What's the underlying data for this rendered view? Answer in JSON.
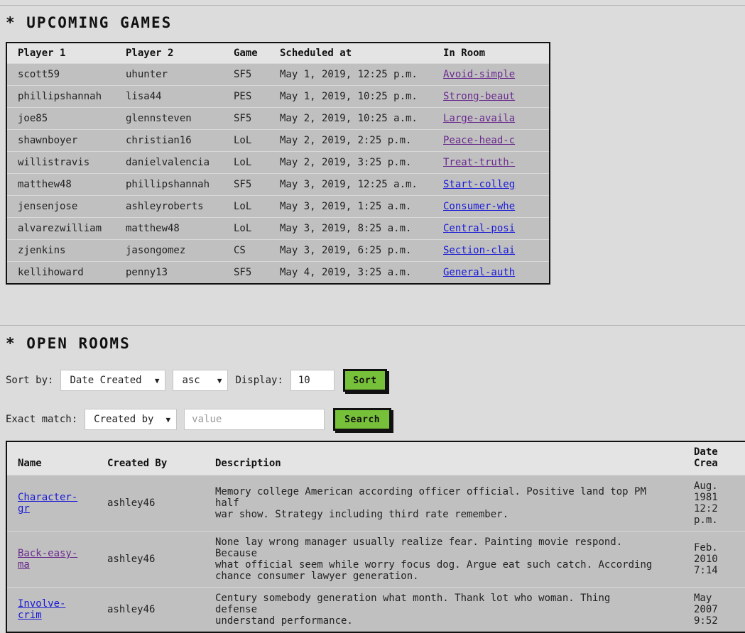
{
  "upcoming": {
    "heading": "* UPCOMING GAMES",
    "columns": [
      "Player 1",
      "Player 2",
      "Game",
      "Scheduled at",
      "In Room"
    ],
    "rows": [
      {
        "p1": "scott59",
        "p2": "uhunter",
        "game": "SF5",
        "when": "May 1, 2019, 12:25 p.m.",
        "room": "Avoid-simple",
        "visited": true
      },
      {
        "p1": "phillipshannah",
        "p2": "lisa44",
        "game": "PES",
        "when": "May 1, 2019, 10:25 p.m.",
        "room": "Strong-beaut",
        "visited": true
      },
      {
        "p1": "joe85",
        "p2": "glennsteven",
        "game": "SF5",
        "when": "May 2, 2019, 10:25 a.m.",
        "room": "Large-availa",
        "visited": true
      },
      {
        "p1": "shawnboyer",
        "p2": "christian16",
        "game": "LoL",
        "when": "May 2, 2019, 2:25 p.m.",
        "room": "Peace-head-c",
        "visited": true
      },
      {
        "p1": "willistravis",
        "p2": "danielvalencia",
        "game": "LoL",
        "when": "May 2, 2019, 3:25 p.m.",
        "room": "Treat-truth-",
        "visited": true
      },
      {
        "p1": "matthew48",
        "p2": "phillipshannah",
        "game": "SF5",
        "when": "May 3, 2019, 12:25 a.m.",
        "room": "Start-colleg",
        "visited": false
      },
      {
        "p1": "jensenjose",
        "p2": "ashleyroberts",
        "game": "LoL",
        "when": "May 3, 2019, 1:25 a.m.",
        "room": "Consumer-whe",
        "visited": false
      },
      {
        "p1": "alvarezwilliam",
        "p2": "matthew48",
        "game": "LoL",
        "when": "May 3, 2019, 8:25 a.m.",
        "room": "Central-posi",
        "visited": false
      },
      {
        "p1": "zjenkins",
        "p2": "jasongomez",
        "game": "CS",
        "when": "May 3, 2019, 6:25 p.m.",
        "room": "Section-clai",
        "visited": false
      },
      {
        "p1": "kellihoward",
        "p2": "penny13",
        "game": "SF5",
        "when": "May 4, 2019, 3:25 a.m.",
        "room": "General-auth",
        "visited": false
      }
    ]
  },
  "open_rooms": {
    "heading": "* OPEN ROOMS",
    "sort": {
      "label": "Sort by:",
      "field_value": "Date Created",
      "order_value": "asc",
      "display_label": "Display:",
      "display_value": "10",
      "button": "Sort"
    },
    "filter": {
      "label": "Exact match:",
      "field_value": "Created by",
      "placeholder": "value",
      "button": "Search"
    },
    "columns": {
      "name": "Name",
      "created_by": "Created By",
      "description": "Description",
      "date_line1": "Date",
      "date_line2": "Crea"
    },
    "rows": [
      {
        "name_line1": "Character-",
        "name_line2": "gr",
        "visited": false,
        "created_by": "ashley46",
        "desc_lines": [
          "Memory college American according officer official. Positive land top PM half",
          "war show. Strategy including third rate remember."
        ],
        "date_lines": [
          "Aug.",
          "1981",
          "12:2",
          "p.m."
        ]
      },
      {
        "name_line1": "Back-easy-",
        "name_line2": "ma",
        "visited": true,
        "created_by": "ashley46",
        "desc_lines": [
          "None lay wrong manager usually realize fear. Painting movie respond. Because",
          "what official seem while worry focus dog. Argue eat such catch. According",
          "chance consumer lawyer generation."
        ],
        "date_lines": [
          "Feb.",
          "2010",
          "7:14"
        ]
      },
      {
        "name_line1": "Involve-",
        "name_line2": "crim",
        "visited": false,
        "created_by": "ashley46",
        "desc_lines": [
          "Century somebody generation what month. Thank lot who woman. Thing defense",
          "understand performance."
        ],
        "date_lines": [
          "May",
          "2007",
          "9:52"
        ]
      }
    ]
  },
  "colors": {
    "background": "#dcdcdc",
    "table_body": "#c0c0c0",
    "header_row": "#e4e4e4",
    "button": "#77c03a",
    "link": "#1a1ad6",
    "visited_link": "#6a2a8e"
  }
}
